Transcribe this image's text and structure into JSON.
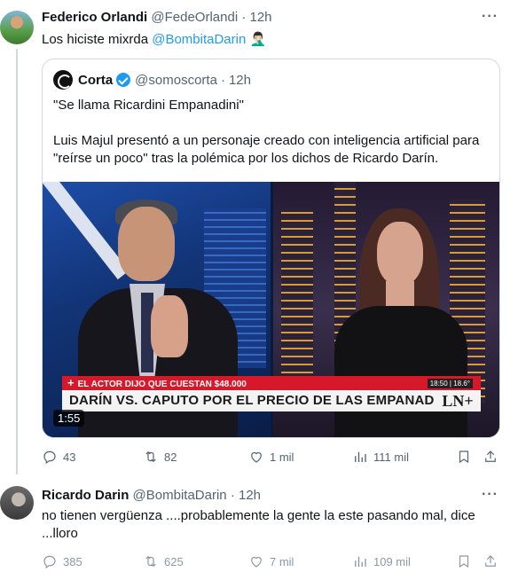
{
  "tweet1": {
    "name": "Federico Orlandi",
    "handle": "@FedeOrlandi",
    "time": "12h",
    "text_before": "Los hiciste mixrda ",
    "mention": "@BombitaDarin",
    "emoji": "🤦🏻‍♂️",
    "quote": {
      "name": "Corta",
      "handle": "@somoscorta",
      "time": "12h",
      "line1": "\"Se llama Ricardini Empanadini\"",
      "line2": "Luis Majul presentó a un personaje creado con inteligencia artificial para \"reírse un poco\" tras la polémica por los dichos de Ricardo Darín.",
      "video": {
        "ticker_top": "EL ACTOR DIJO QUE CUESTAN $48.000",
        "ticker_main": "DARÍN VS. CAPUTO POR EL PRECIO DE LAS EMPANADAS",
        "clock": "18:50 | 18.6°",
        "channel": "LN+",
        "duration": "1:55"
      }
    },
    "stats": {
      "replies": "43",
      "reposts": "82",
      "likes": "1 mil",
      "views": "111 mil"
    }
  },
  "tweet2": {
    "name": "Ricardo Darin",
    "handle": "@BombitaDarin",
    "time": "12h",
    "text": "no tienen vergüenza ....probablemente la gente la este pasando mal, dice ...lloro",
    "stats": {
      "replies": "385",
      "reposts": "625",
      "likes": "7 mil",
      "views": "109 mil"
    }
  },
  "separator_dot": "·",
  "more_glyph": "···",
  "icons": [
    "reply-icon",
    "repost-icon",
    "like-icon",
    "views-icon",
    "bookmark-icon",
    "share-icon",
    "verified-badge-icon"
  ],
  "colors": {
    "link": "#1d9bf0",
    "muted": "#536471",
    "border": "#cfd9de",
    "ticker_red": "#d7172a",
    "verified": "#1d9bf0"
  }
}
